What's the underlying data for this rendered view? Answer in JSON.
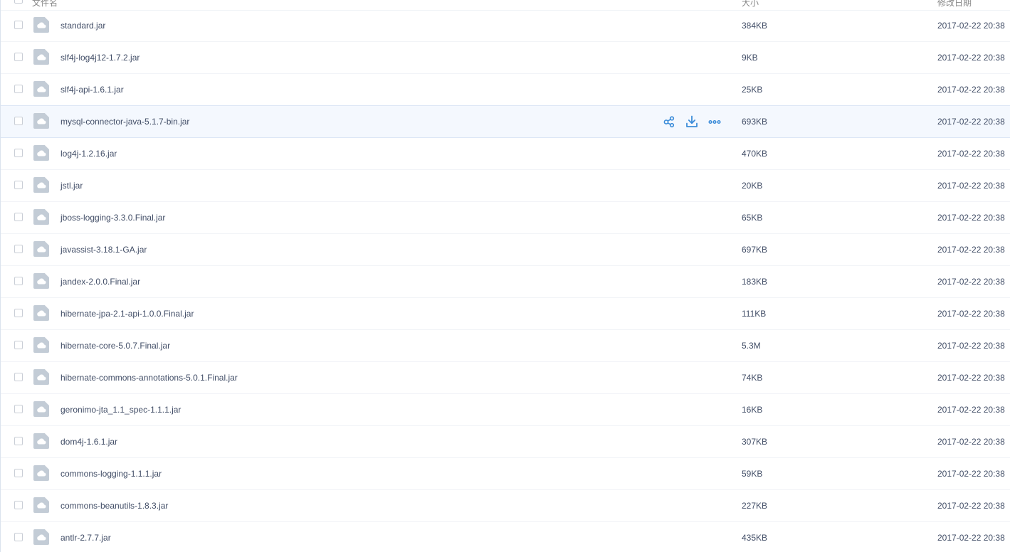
{
  "header": {
    "name_label": "文件名",
    "size_label": "大小",
    "date_label": "修改日期"
  },
  "colors": {
    "accent": "#3b8cd9",
    "file_icon": "#c3ccd6",
    "hover_row": "#f4f8fe"
  },
  "row_actions": {
    "share_icon": "share-icon",
    "download_icon": "download-icon",
    "more_icon": "more-icon"
  },
  "files": [
    {
      "name": "standard.jar",
      "size": "384KB",
      "date": "2017-02-22 20:38"
    },
    {
      "name": "slf4j-log4j12-1.7.2.jar",
      "size": "9KB",
      "date": "2017-02-22 20:38"
    },
    {
      "name": "slf4j-api-1.6.1.jar",
      "size": "25KB",
      "date": "2017-02-22 20:38"
    },
    {
      "name": "mysql-connector-java-5.1.7-bin.jar",
      "size": "693KB",
      "date": "2017-02-22 20:38",
      "hovered": true
    },
    {
      "name": "log4j-1.2.16.jar",
      "size": "470KB",
      "date": "2017-02-22 20:38"
    },
    {
      "name": "jstl.jar",
      "size": "20KB",
      "date": "2017-02-22 20:38"
    },
    {
      "name": "jboss-logging-3.3.0.Final.jar",
      "size": "65KB",
      "date": "2017-02-22 20:38"
    },
    {
      "name": "javassist-3.18.1-GA.jar",
      "size": "697KB",
      "date": "2017-02-22 20:38"
    },
    {
      "name": "jandex-2.0.0.Final.jar",
      "size": "183KB",
      "date": "2017-02-22 20:38"
    },
    {
      "name": "hibernate-jpa-2.1-api-1.0.0.Final.jar",
      "size": "111KB",
      "date": "2017-02-22 20:38"
    },
    {
      "name": "hibernate-core-5.0.7.Final.jar",
      "size": "5.3M",
      "date": "2017-02-22 20:38"
    },
    {
      "name": "hibernate-commons-annotations-5.0.1.Final.jar",
      "size": "74KB",
      "date": "2017-02-22 20:38"
    },
    {
      "name": "geronimo-jta_1.1_spec-1.1.1.jar",
      "size": "16KB",
      "date": "2017-02-22 20:38"
    },
    {
      "name": "dom4j-1.6.1.jar",
      "size": "307KB",
      "date": "2017-02-22 20:38"
    },
    {
      "name": "commons-logging-1.1.1.jar",
      "size": "59KB",
      "date": "2017-02-22 20:38"
    },
    {
      "name": "commons-beanutils-1.8.3.jar",
      "size": "227KB",
      "date": "2017-02-22 20:38"
    },
    {
      "name": "antlr-2.7.7.jar",
      "size": "435KB",
      "date": "2017-02-22 20:38"
    }
  ]
}
